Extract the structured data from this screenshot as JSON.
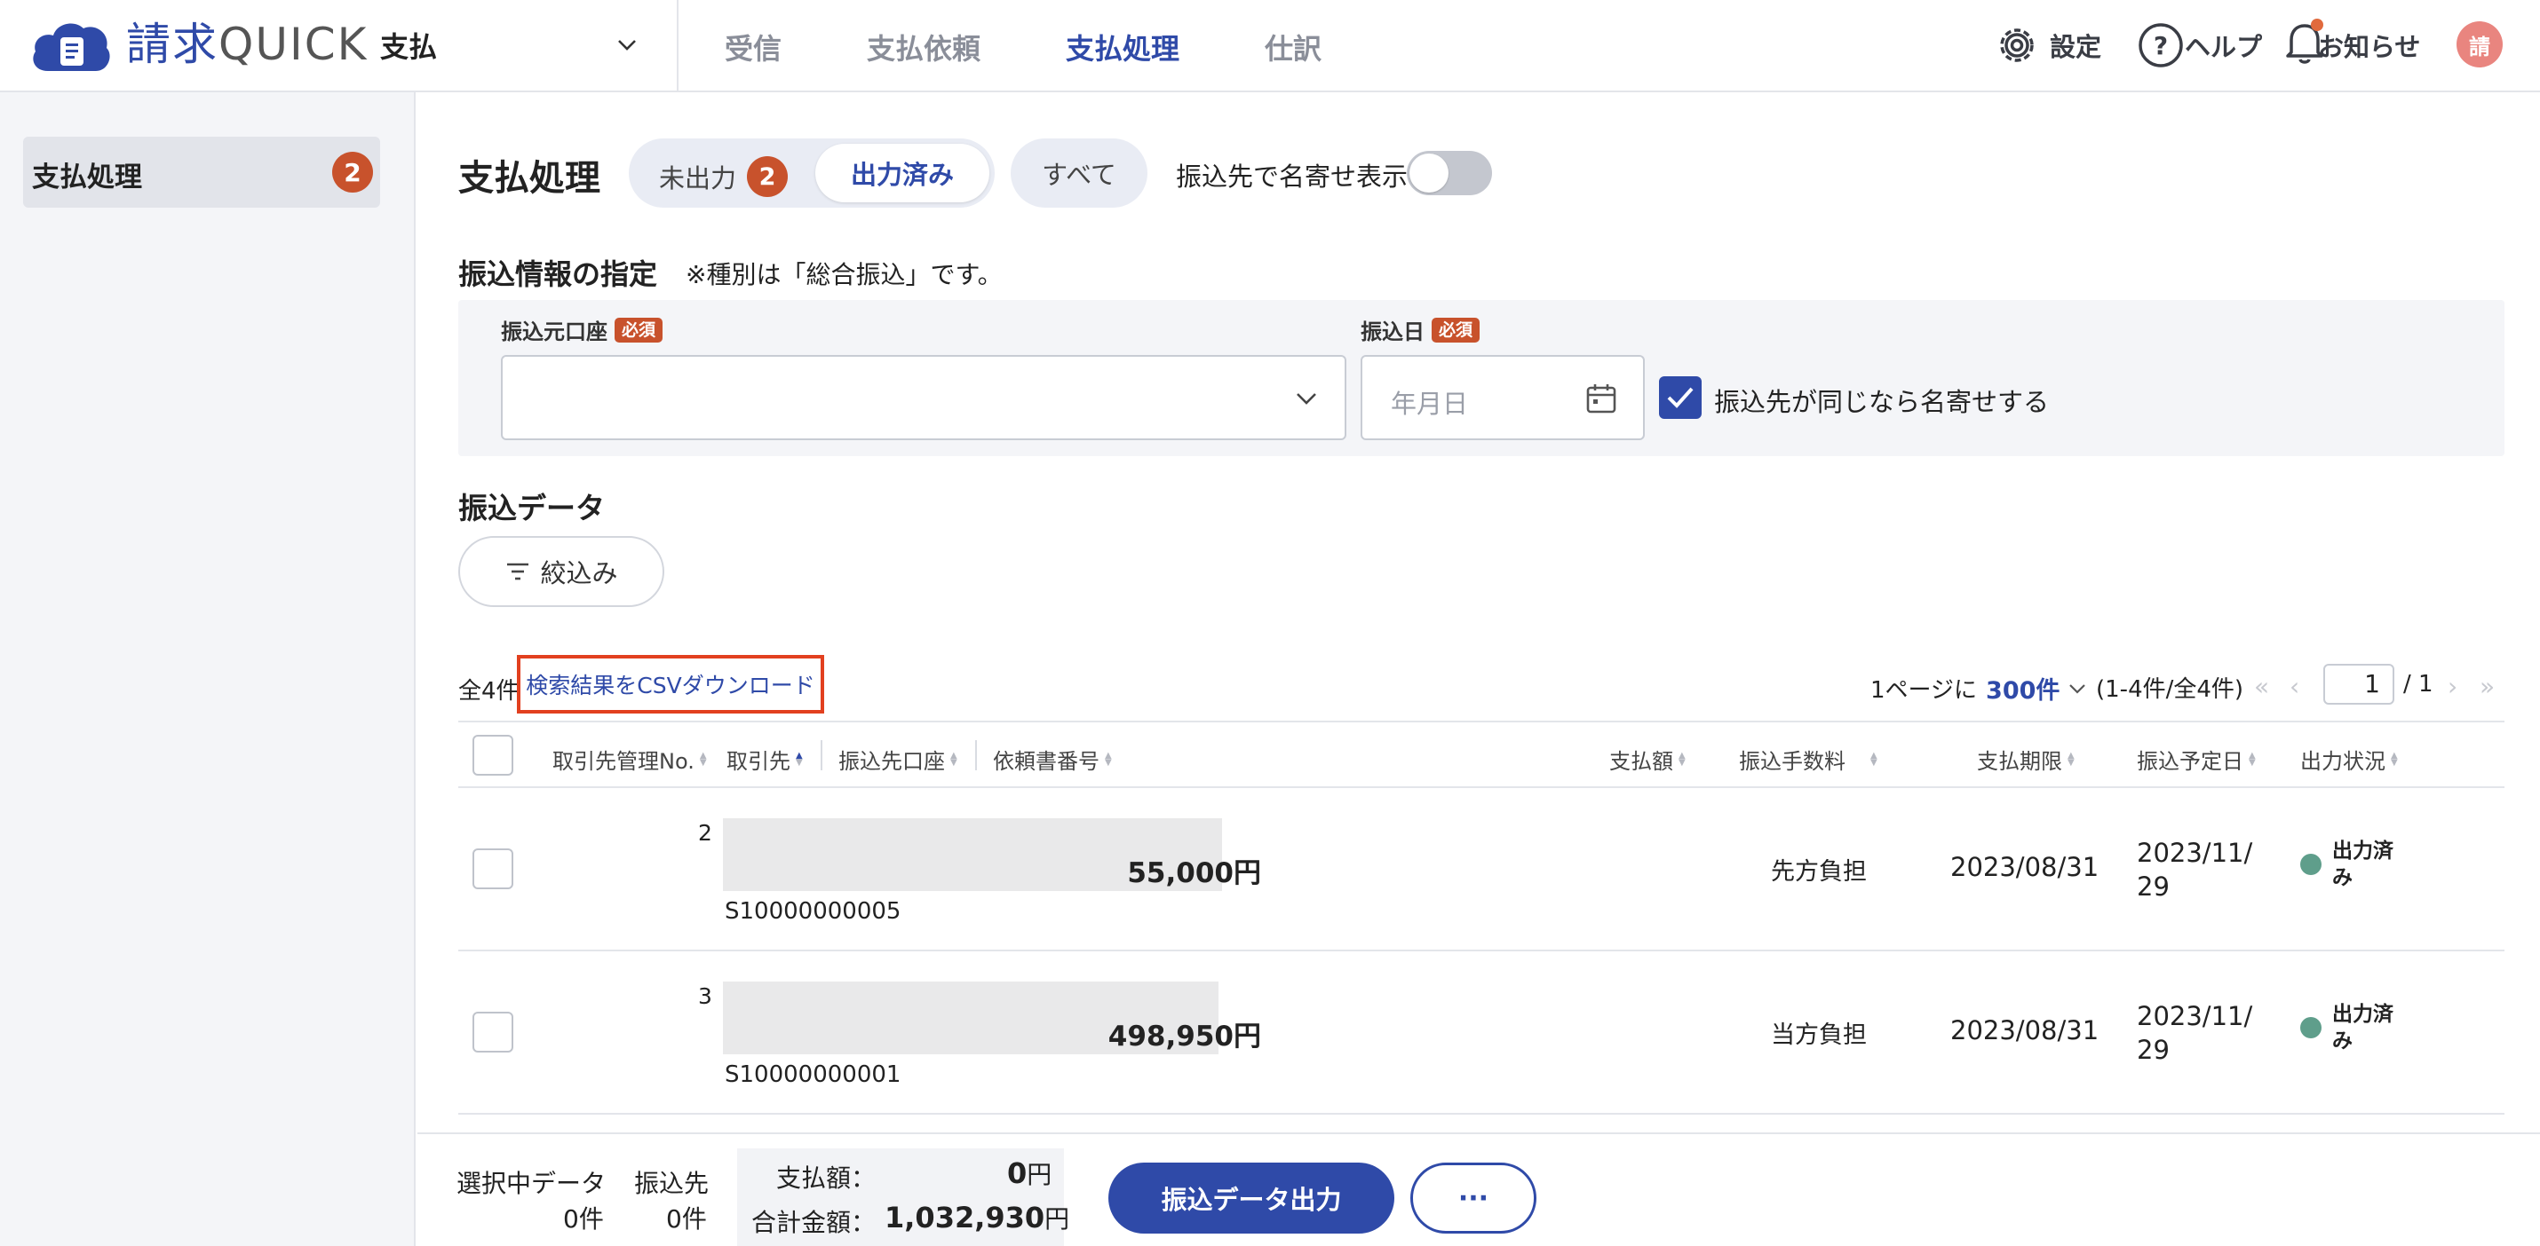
{
  "header": {
    "brand": "請求",
    "brand_suffix": "QUICK",
    "module": "支払",
    "nav": [
      "受信",
      "支払依頼",
      "支払処理",
      "仕訳"
    ],
    "active_nav": "支払処理",
    "settings": "設定",
    "help": "ヘルプ",
    "notifications": "お知らせ",
    "avatar": "請",
    "colors": {
      "accent": "#2f4aa8",
      "badge": "#c8522c",
      "status": "#5f9e8b",
      "highlight": "#e2401f"
    }
  },
  "sidebar": {
    "items": [
      {
        "label": "支払処理",
        "badge": "2"
      }
    ]
  },
  "main": {
    "title": "支払処理",
    "tabs": {
      "unoutput": "未出力",
      "unoutput_badge": "2",
      "output": "出力済み",
      "all": "すべて"
    },
    "active_tab": "出力済み",
    "toggle_label": "振込先で名寄せ表示",
    "toggle_on": false,
    "transfer_section": {
      "title": "振込情報の指定",
      "note": "※種別は「総合振込」です。",
      "source_account_label": "振込元口座",
      "required": "必須",
      "date_label": "振込日",
      "date_placeholder": "年月日",
      "merge_label": "振込先が同じなら名寄せする",
      "merge_checked": true
    },
    "data_section": {
      "title": "振込データ",
      "filter": "絞込み",
      "count": "全4件",
      "csv": "検索結果をCSVダウンロード",
      "per_page_prefix": "1ページに",
      "per_page": "300件",
      "range": "(1-4件/全4件)",
      "page": "1",
      "page_total": "/ 1"
    },
    "columns": [
      "取引先管理No.",
      "取引先",
      "振込先口座",
      "依頼書番号",
      "支払額",
      "振込手数料",
      "支払期限",
      "振込予定日",
      "出力状況"
    ],
    "rows": [
      {
        "no": "2",
        "code": "S10000000005",
        "amount": "55,000円",
        "fee": "先方負担",
        "due": "2023/08/31",
        "sched_1": "2023/11/",
        "sched_2": "29",
        "status_1": "出力済",
        "status_2": "み"
      },
      {
        "no": "3",
        "code": "S10000000001",
        "amount": "498,950円",
        "fee": "当方負担",
        "due": "2023/08/31",
        "sched_1": "2023/11/",
        "sched_2": "29",
        "status_1": "出力済",
        "status_2": "み"
      }
    ]
  },
  "footer": {
    "selected_label": "選択中データ",
    "selected_count": "0件",
    "payee_label": "振込先",
    "payee_count": "0件",
    "pay_label": "支払額：",
    "pay_value": "0",
    "total_label": "合計金額：",
    "total_value": "1,032,930",
    "unit": "円",
    "output_button": "振込データ出力",
    "more_button": "···"
  }
}
